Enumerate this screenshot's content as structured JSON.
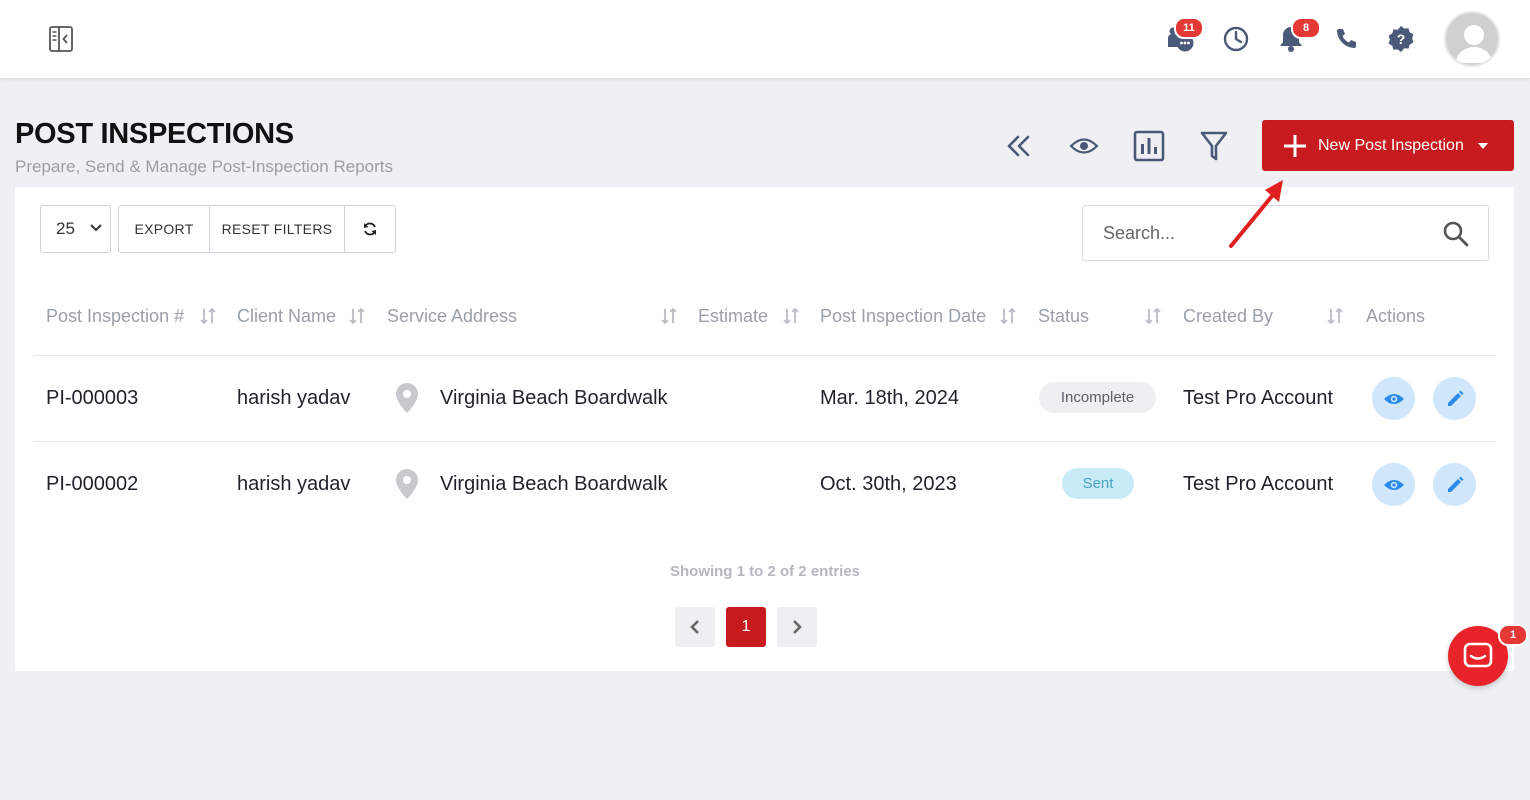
{
  "header": {
    "messages_badge": "11",
    "notifications_badge": "8",
    "chat_badge": "1"
  },
  "page": {
    "title": "POST INSPECTIONS",
    "subtitle": "Prepare, Send & Manage Post-Inspection Reports"
  },
  "toolbar": {
    "new_button_label": "New Post Inspection",
    "page_size": "25",
    "export_label": "EXPORT",
    "reset_label": "RESET FILTERS",
    "search_placeholder": "Search..."
  },
  "table": {
    "columns": [
      "Post Inspection #",
      "Client Name",
      "Service Address",
      "Estimate",
      "Post Inspection Date",
      "Status",
      "Created By",
      "Actions"
    ],
    "rows": [
      {
        "id": "PI-000003",
        "client": "harish yadav",
        "address": "Virginia Beach Boardwalk",
        "estimate": "",
        "date": "Mar. 18th, 2024",
        "status": "Incomplete",
        "created_by": "Test Pro Account"
      },
      {
        "id": "PI-000002",
        "client": "harish yadav",
        "address": "Virginia Beach Boardwalk",
        "estimate": "",
        "date": "Oct. 30th, 2023",
        "status": "Sent",
        "created_by": "Test Pro Account"
      }
    ]
  },
  "pagination": {
    "info": "Showing 1 to 2 of 2 entries",
    "current_page": "1"
  },
  "colors": {
    "brand_red": "#c81b1f",
    "icon_slate": "#4a5a78",
    "action_blue": "#2a8ce8"
  }
}
